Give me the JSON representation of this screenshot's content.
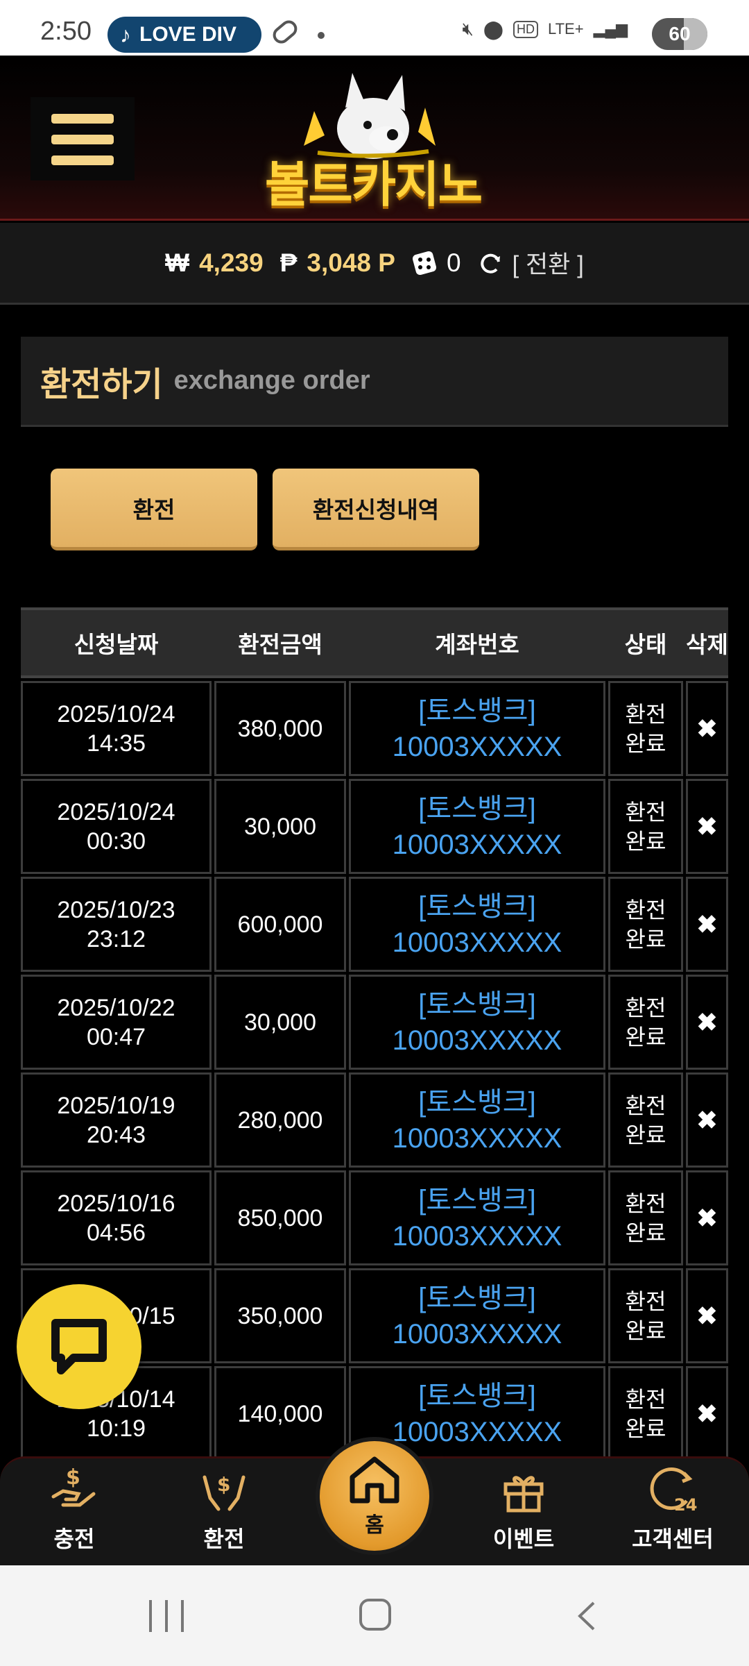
{
  "status_bar": {
    "time": "2:50",
    "music_chip": "LOVE DIV",
    "network": "LTE+",
    "battery": "60"
  },
  "header": {
    "logo_text": "볼트카지노"
  },
  "balance": {
    "won_symbol": "₩",
    "won_amount": "4,239",
    "point_symbol": "₱",
    "point_amount": "3,048 P",
    "chip_count": "0",
    "convert_label": "[ 전환 ]"
  },
  "page": {
    "title_ko": "환전하기",
    "title_en": "exchange order"
  },
  "tabs": [
    {
      "label": "환전"
    },
    {
      "label": "환전신청내역"
    }
  ],
  "table": {
    "headers": {
      "date": "신청날짜",
      "amount": "환전금액",
      "account": "계좌번호",
      "status": "상태",
      "delete": "삭제"
    },
    "rows": [
      {
        "date": "2025/10/24",
        "time": "14:35",
        "amount": "380,000",
        "bank": "[토스뱅크]",
        "account": "10003XXXXX",
        "status1": "환전",
        "status2": "완료",
        "delete": "✖"
      },
      {
        "date": "2025/10/24",
        "time": "00:30",
        "amount": "30,000",
        "bank": "[토스뱅크]",
        "account": "10003XXXXX",
        "status1": "환전",
        "status2": "완료",
        "delete": "✖"
      },
      {
        "date": "2025/10/23",
        "time": "23:12",
        "amount": "600,000",
        "bank": "[토스뱅크]",
        "account": "10003XXXXX",
        "status1": "환전",
        "status2": "완료",
        "delete": "✖"
      },
      {
        "date": "2025/10/22",
        "time": "00:47",
        "amount": "30,000",
        "bank": "[토스뱅크]",
        "account": "10003XXXXX",
        "status1": "환전",
        "status2": "완료",
        "delete": "✖"
      },
      {
        "date": "2025/10/19",
        "time": "20:43",
        "amount": "280,000",
        "bank": "[토스뱅크]",
        "account": "10003XXXXX",
        "status1": "환전",
        "status2": "완료",
        "delete": "✖"
      },
      {
        "date": "2025/10/16",
        "time": "04:56",
        "amount": "850,000",
        "bank": "[토스뱅크]",
        "account": "10003XXXXX",
        "status1": "환전",
        "status2": "완료",
        "delete": "✖"
      },
      {
        "date": "2025/10/15",
        "time": "",
        "amount": "350,000",
        "bank": "[토스뱅크]",
        "account": "10003XXXXX",
        "status1": "환전",
        "status2": "완료",
        "delete": "✖"
      },
      {
        "date": "2025/10/14",
        "time": "10:19",
        "amount": "140,000",
        "bank": "[토스뱅크]",
        "account": "10003XXXXX",
        "status1": "환전",
        "status2": "완료",
        "delete": "✖"
      }
    ]
  },
  "bottom_nav": {
    "items": [
      {
        "label": "충전",
        "icon": "hand-coin-icon"
      },
      {
        "label": "환전",
        "icon": "hands-money-icon"
      },
      {
        "label": "홈",
        "icon": "home-icon"
      },
      {
        "label": "이벤트",
        "icon": "gift-icon"
      },
      {
        "label": "고객센터",
        "icon": "support-24-icon"
      }
    ]
  },
  "colors": {
    "accent_gold": "#f6d28a",
    "button_gold": "#e9b96b",
    "link_blue": "#4aa3f0",
    "chat_yellow": "#f6d330"
  }
}
